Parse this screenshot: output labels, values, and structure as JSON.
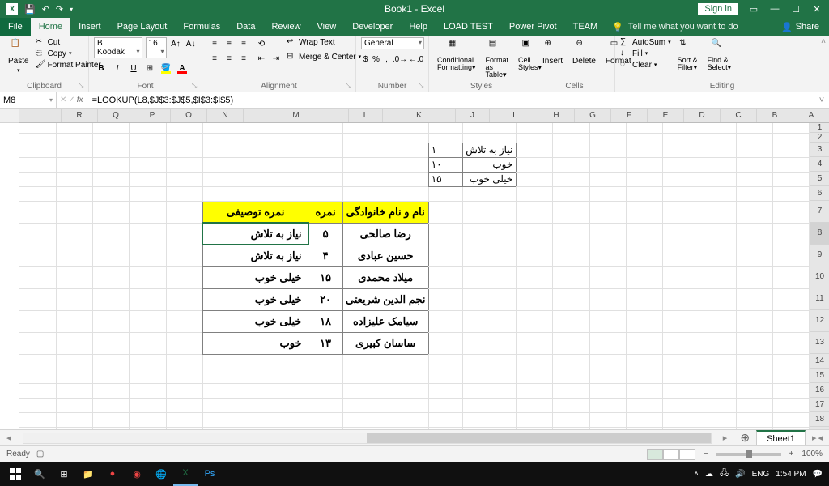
{
  "title": "Book1 - Excel",
  "signin": "Sign in",
  "menu": {
    "file": "File",
    "home": "Home",
    "insert": "Insert",
    "pagelayout": "Page Layout",
    "formulas": "Formulas",
    "data": "Data",
    "review": "Review",
    "view": "View",
    "developer": "Developer",
    "help": "Help",
    "loadtest": "LOAD TEST",
    "powerpivot": "Power Pivot",
    "team": "TEAM",
    "tell": "Tell me what you want to do",
    "share": "Share"
  },
  "ribbon": {
    "clipboard": {
      "label": "Clipboard",
      "paste": "Paste",
      "cut": "Cut",
      "copy": "Copy",
      "painter": "Format Painter"
    },
    "font": {
      "label": "Font",
      "name": "B Koodak",
      "size": "16"
    },
    "alignment": {
      "label": "Alignment",
      "wrap": "Wrap Text",
      "merge": "Merge & Center"
    },
    "number": {
      "label": "Number",
      "format": "General"
    },
    "styles": {
      "label": "Styles",
      "cond": "Conditional Formatting",
      "table": "Format as Table",
      "cell": "Cell Styles"
    },
    "cells": {
      "label": "Cells",
      "insert": "Insert",
      "delete": "Delete",
      "format": "Format"
    },
    "editing": {
      "label": "Editing",
      "autosum": "AutoSum",
      "fill": "Fill",
      "clear": "Clear",
      "sort": "Sort & Filter",
      "find": "Find & Select"
    }
  },
  "namebox": "M8",
  "formula": "=LOOKUP(L8,$J$3:$J$5,$I$3:$I$5)",
  "columns": [
    "A",
    "B",
    "C",
    "D",
    "E",
    "F",
    "G",
    "H",
    "I",
    "J",
    "K",
    "L",
    "M",
    "N",
    "O",
    "P",
    "Q",
    "R"
  ],
  "col_widths": {
    "default": 45,
    "K": 90,
    "L": 42,
    "M": 130,
    "I": 60,
    "J": 42
  },
  "row_heights": {
    "default": 18,
    "tall_start": 7,
    "tall": 27,
    "rows": 21
  },
  "lookup_table": [
    {
      "label": "نیاز به تلاش",
      "value": "۱"
    },
    {
      "label": "خوب",
      "value": "۱۰"
    },
    {
      "label": "خیلی خوب",
      "value": "۱۵"
    }
  ],
  "main_table": {
    "headers": {
      "name": "نام و نام خانوادگی",
      "score": "نمره",
      "desc": "نمره توصیفی"
    },
    "rows": [
      {
        "name": "رضا صالحی",
        "score": "۵",
        "desc": "نیاز به تلاش"
      },
      {
        "name": "حسین عبادی",
        "score": "۴",
        "desc": "نیاز به تلاش"
      },
      {
        "name": "میلاد محمدی",
        "score": "۱۵",
        "desc": "خیلی خوب"
      },
      {
        "name": "نجم الدین شریعتی",
        "score": "۲۰",
        "desc": "خیلی خوب"
      },
      {
        "name": "سیامک علیزاده",
        "score": "۱۸",
        "desc": "خیلی خوب"
      },
      {
        "name": "ساسان کبیری",
        "score": "۱۳",
        "desc": "خوب"
      }
    ]
  },
  "sheet": "Sheet1",
  "status": {
    "ready": "Ready",
    "zoom": "100%",
    "lang": "ENG",
    "time": "1:54 PM"
  }
}
